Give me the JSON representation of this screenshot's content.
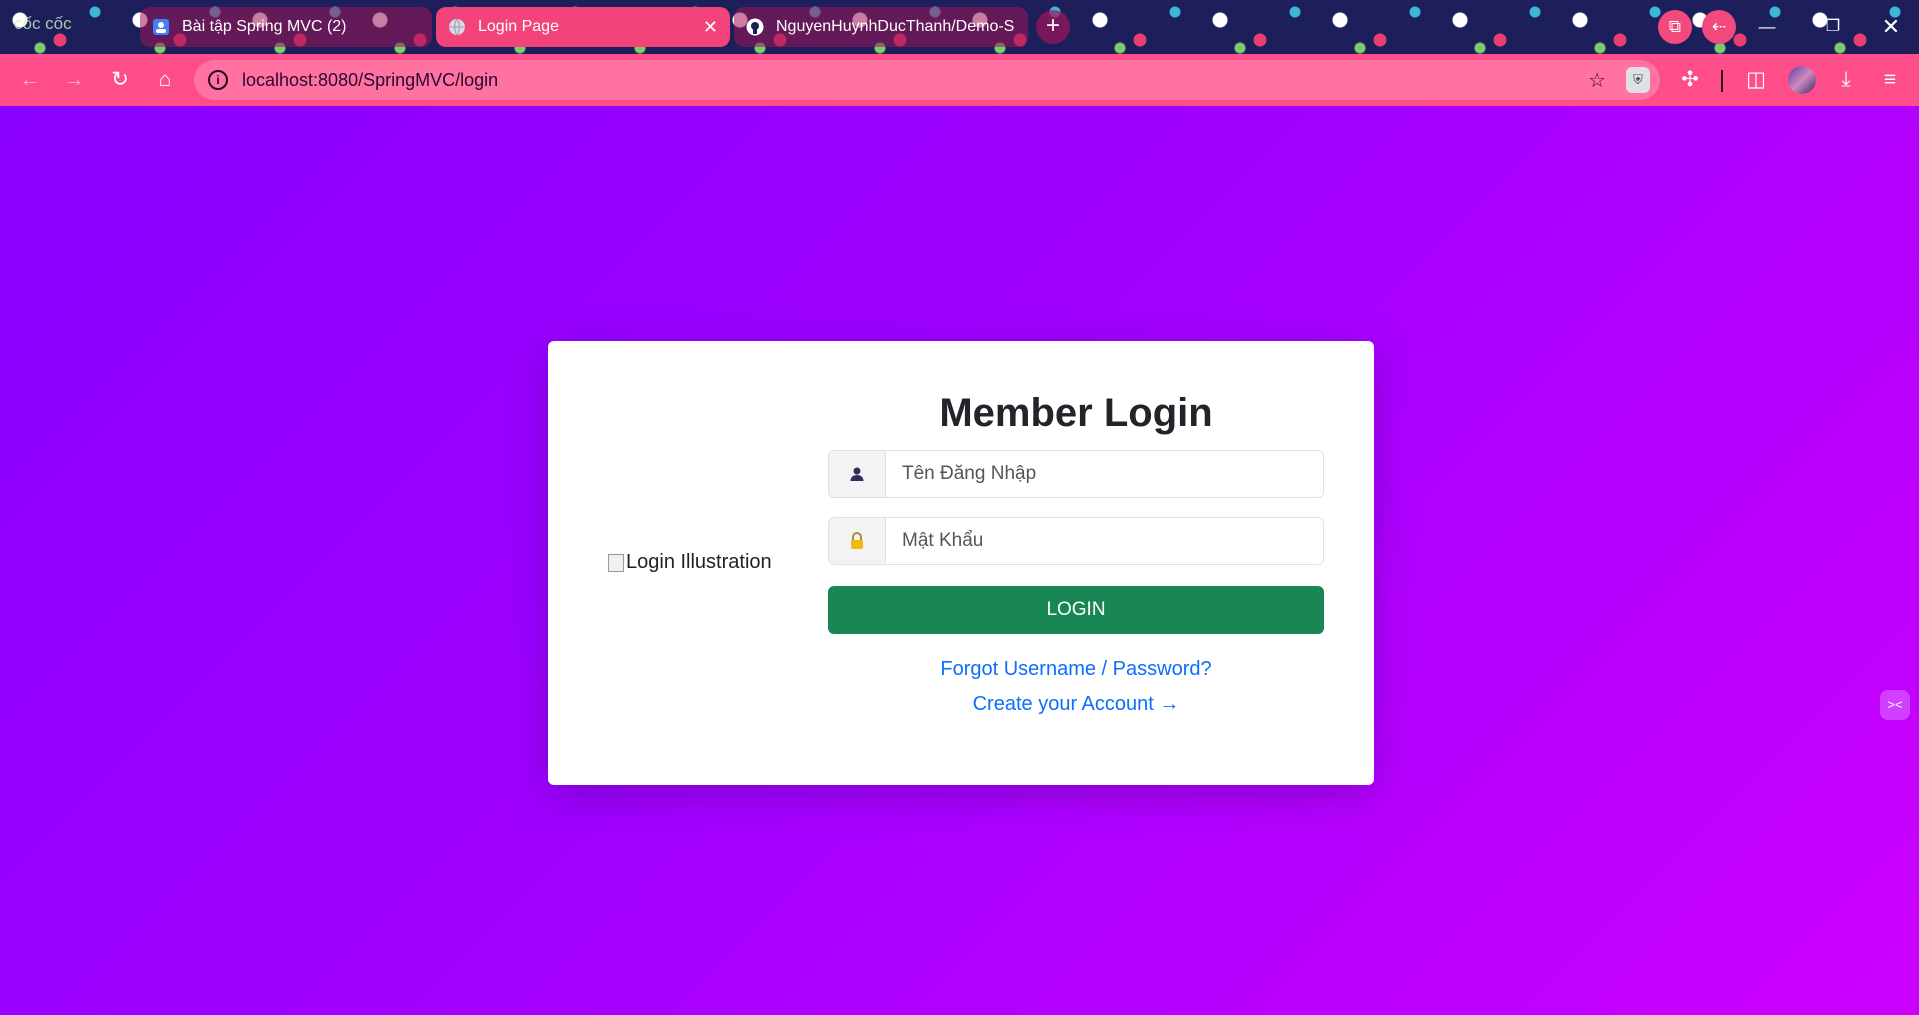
{
  "browser": {
    "brand": "cốc cốc",
    "tabs": [
      {
        "title": "Bài tập Spring MVC (2)",
        "icon": "contacts-icon"
      },
      {
        "title": "Login Page",
        "icon": "globe-icon",
        "close": "✕"
      },
      {
        "title": "NguyenHuynhDucThanh/Demo-S",
        "icon": "github-icon"
      }
    ],
    "new_tab": "+",
    "address": "localhost:8080/SpringMVC/login",
    "accent": "#ff4d8a"
  },
  "login": {
    "heading": "Member Login",
    "image_alt": "Login Illustration",
    "username_placeholder": "Tên Đăng Nhập",
    "password_placeholder": "Mật Khẩu",
    "button": "LOGIN",
    "forgot": "Forgot Username / Password?",
    "create": "Create your Account →",
    "button_color": "#198754",
    "link_color": "#0d6efd"
  }
}
